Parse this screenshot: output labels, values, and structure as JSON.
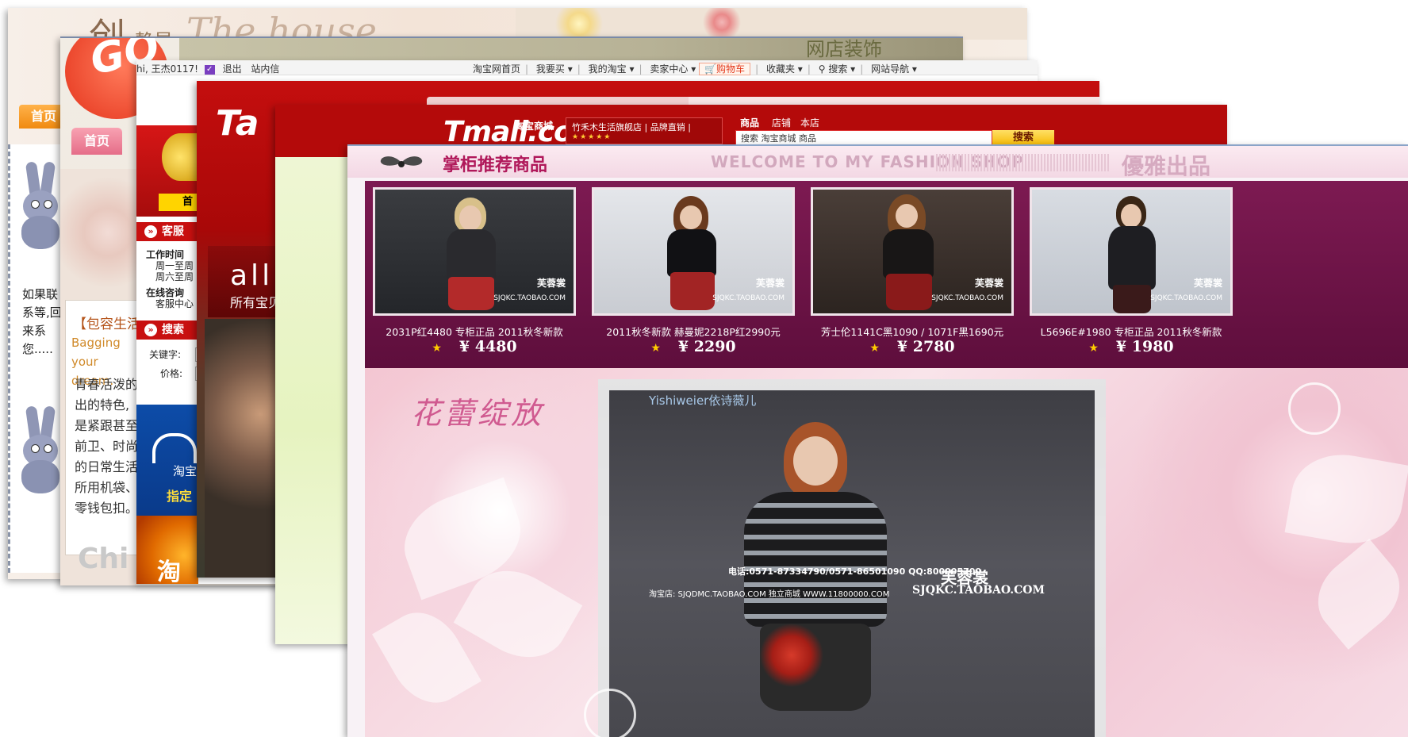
{
  "layer1": {
    "logo_cn": "创",
    "logo_cn2": "静星",
    "logo_en": "The house",
    "tab_home": "首页",
    "contact_text": "如果联系等,回来系您....."
  },
  "layer2": {
    "logo": "GO",
    "banner_text": "网店装饰",
    "tab_home": "首页",
    "content_title": "【包容生活",
    "content_en": "Bagging your dream.",
    "content_cn": "青春活泼的出的特色,是紧跟甚至前卫、时尚的日常生活所用机袋、零钱包扣。",
    "footer_logo": "Chi"
  },
  "taobao_nav": {
    "greeting": "hi, 王杰0117!",
    "logout": "退出",
    "inbox": "站内信",
    "items": [
      "淘宝网首页",
      "我要买",
      "我的淘宝",
      "卖家中心",
      "购物车",
      "收藏夹",
      "搜索",
      "网站导航"
    ]
  },
  "layer3": {
    "tab_home": "首",
    "service_title": "客服",
    "work_time": "工作时间",
    "weekday": "周一至周",
    "weekend": "周六至周",
    "online": "在线咨询",
    "service_center": "客服中心",
    "search_title": "搜索",
    "keyword_label": "关键字:",
    "price_label": "价格:",
    "taobao_label": "淘宝",
    "designated": "指定",
    "footer_char": "淘"
  },
  "layer4": {
    "logo": "Ta",
    "all_text": "all",
    "all_sub": "所有宝贝"
  },
  "tmall": {
    "logo": "Tmall.com",
    "logo_cn": "淘宝商城",
    "shop_name": "竹禾木生活旗舰店 | 品牌直销 |",
    "shop_stars": "★★★★★",
    "tabs": [
      "商品",
      "店铺",
      "本店"
    ],
    "search_value": "搜索 淘宝商城 商品",
    "search_button": "搜索"
  },
  "fashion": {
    "header_title": "掌柜推荐商品",
    "header_welcome": "WELCOME TO MY FASHION SHOP",
    "header_brand": "優雅出品",
    "products": [
      {
        "name": "2031P红4480 专柜正品 2011秋冬新款",
        "price": "¥ 4480",
        "dress": "#2a2a2e",
        "skirt": "#b32a2a",
        "bg": "#2b2d30"
      },
      {
        "name": "2011秋冬新款 赫曼妮2218P红2990元",
        "price": "¥ 2290",
        "dress": "#111114",
        "skirt": "#a22424",
        "bg": "#d9dce2"
      },
      {
        "name": "芳士伦1141C黑1090 / 1071F黑1690元",
        "price": "¥ 2780",
        "dress": "#181616",
        "skirt": "#8a1a1a",
        "bg": "#3c3430"
      },
      {
        "name": "L5696E#1980 专柜正品 2011秋冬新款",
        "price": "¥ 1980",
        "dress": "#1e1e22",
        "skirt": "#3a1a1a",
        "bg": "#cfd4db"
      }
    ],
    "watermark": "芙蓉裳",
    "watermark_url": "SJQKC.TAOBAO.COM",
    "bloom_title": "花蕾绽放",
    "frame_brand": "Yishiweier依诗薇儿",
    "frame_phone": "电话:0571-87334790/0571-86501090 QQ:800005700",
    "frame_site": "淘宝店: SJQDMC.TAOBAO.COM 独立商城 WWW.11800000.COM",
    "frame_logo": "芙蓉裳",
    "frame_url": "SJQKC.TAOBAO.COM"
  }
}
